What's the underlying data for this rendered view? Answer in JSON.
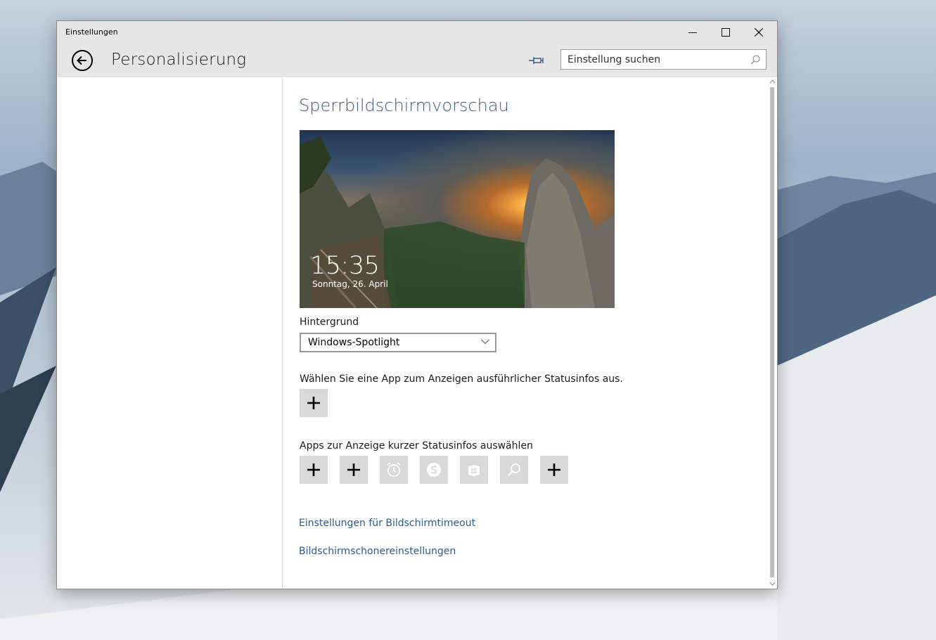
{
  "window": {
    "title": "Einstellungen"
  },
  "header": {
    "page_title": "Personalisierung",
    "search_placeholder": "Einstellung suchen"
  },
  "lock_screen": {
    "section_title": "Sperrbildschirmvorschau",
    "preview_time": "15:35",
    "preview_date": "Sonntag, 26. April",
    "background_label": "Hintergrund",
    "background_value": "Windows-Spotlight",
    "detailed_status_label": "Wählen Sie eine App zum Anzeigen ausführlicher Statusinfos aus.",
    "quick_status_label": "Apps zur Anzeige kurzer Statusinfos auswählen",
    "quick_status_apps": [
      {
        "icon": "plus-icon"
      },
      {
        "icon": "plus-icon"
      },
      {
        "icon": "alarm-icon"
      },
      {
        "icon": "skype-icon"
      },
      {
        "icon": "store-icon"
      },
      {
        "icon": "search-icon"
      },
      {
        "icon": "plus-icon"
      }
    ],
    "links": {
      "timeout": "Einstellungen für Bildschirmtimeout",
      "screensaver": "Bildschirmschonereinstellungen"
    }
  },
  "colors": {
    "accent_title": "#3a5a80",
    "link": "#2b5c8f",
    "tile_bg": "#d9d9d9",
    "chrome_bg": "#e6e6e6"
  }
}
